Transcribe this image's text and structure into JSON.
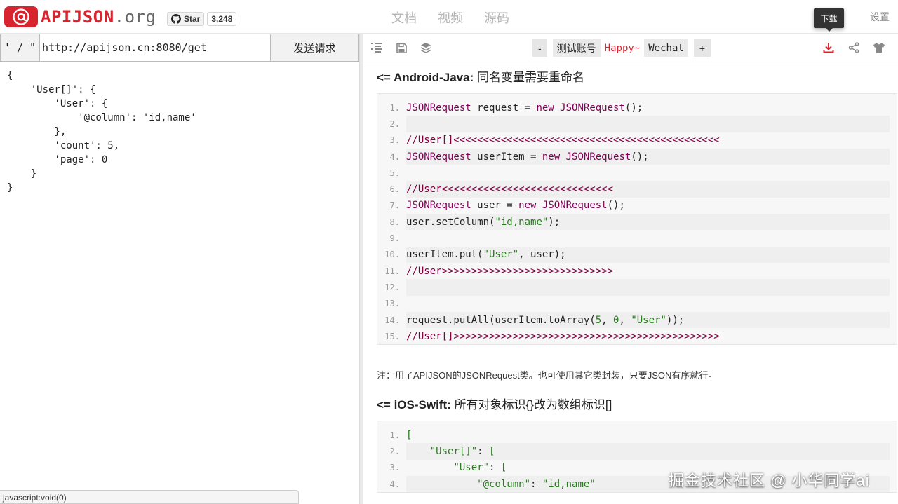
{
  "header": {
    "logo_symbol": "@",
    "logo_name": "APIJSON",
    "logo_tld": ".org",
    "star_label": "Star",
    "star_count": "3,248",
    "nav": [
      "文档",
      "视频",
      "源码"
    ],
    "settings": "设置",
    "tooltip": "下载"
  },
  "left": {
    "quote_label": "' / \"",
    "url_value": "http://apijson.cn:8080/get",
    "send_label": "发送请求",
    "request_body": "{\n    'User[]': {\n        'User': {\n            '@column': 'id,name'\n        },\n        'count': 5,\n        'page': 0\n    }\n}",
    "status_text": "javascript:void(0)"
  },
  "toolbar": {
    "icons": [
      "list-icon",
      "save-icon",
      "layers-icon",
      "download-icon",
      "share-icon",
      "shirt-icon"
    ],
    "minus": "-",
    "plus": "+",
    "accounts": [
      {
        "label": "测试账号",
        "active": false
      },
      {
        "label": "Happy~",
        "active": true
      },
      {
        "label": "Wechat",
        "active": false
      }
    ],
    "accent": "#d8242f"
  },
  "sections": [
    {
      "title_prefix": "<= Android-Java:",
      "title_rest": " 同名变量需要重命名",
      "lines": [
        [
          [
            "k",
            "JSONRequest"
          ],
          [
            "t",
            " request = "
          ],
          [
            "k",
            "new"
          ],
          [
            "t",
            " "
          ],
          [
            "k",
            "JSONRequest"
          ],
          [
            "t",
            "();"
          ]
        ],
        [],
        [
          [
            "c",
            "//User[]<<<<<<<<<<<<<<<<<<<<<<<<<<<<<<<<<<<<<<<<<<<<<"
          ]
        ],
        [
          [
            "k",
            "JSONRequest"
          ],
          [
            "t",
            " userItem = "
          ],
          [
            "k",
            "new"
          ],
          [
            "t",
            " "
          ],
          [
            "k",
            "JSONRequest"
          ],
          [
            "t",
            "();"
          ]
        ],
        [],
        [
          [
            "c",
            "//User<<<<<<<<<<<<<<<<<<<<<<<<<<<<<"
          ]
        ],
        [
          [
            "k",
            "JSONRequest"
          ],
          [
            "t",
            " user = "
          ],
          [
            "k",
            "new"
          ],
          [
            "t",
            " "
          ],
          [
            "k",
            "JSONRequest"
          ],
          [
            "t",
            "();"
          ]
        ],
        [
          [
            "t",
            "user.setColumn("
          ],
          [
            "s",
            "\"id,name\""
          ],
          [
            "t",
            ");"
          ]
        ],
        [],
        [
          [
            "t",
            "userItem.put("
          ],
          [
            "s",
            "\"User\""
          ],
          [
            "t",
            ", user);"
          ]
        ],
        [
          [
            "c",
            "//User>>>>>>>>>>>>>>>>>>>>>>>>>>>>>"
          ]
        ],
        [],
        [],
        [
          [
            "t",
            "request.putAll(userItem.toArray("
          ],
          [
            "s",
            "5"
          ],
          [
            "t",
            ", "
          ],
          [
            "s",
            "0"
          ],
          [
            "t",
            ", "
          ],
          [
            "s",
            "\"User\""
          ],
          [
            "t",
            "));"
          ]
        ],
        [
          [
            "c",
            "//User[]>>>>>>>>>>>>>>>>>>>>>>>>>>>>>>>>>>>>>>>>>>>>>"
          ]
        ]
      ]
    },
    {
      "note": "注：用了APIJSON的JSONRequest类。也可使用其它类封装，只要JSON有序就行。"
    },
    {
      "title_prefix": "<= iOS-Swift:",
      "title_rest": " 所有对象标识{}改为数组标识[]",
      "lines": [
        [
          [
            "s",
            "["
          ]
        ],
        [
          [
            "t",
            "    "
          ],
          [
            "s",
            "\"User[]\""
          ],
          [
            "t",
            ": "
          ],
          [
            "s",
            "["
          ]
        ],
        [
          [
            "t",
            "        "
          ],
          [
            "s",
            "\"User\""
          ],
          [
            "t",
            ": "
          ],
          [
            "s",
            "["
          ]
        ],
        [
          [
            "t",
            "            "
          ],
          [
            "s",
            "\"@column\""
          ],
          [
            "t",
            ": "
          ],
          [
            "s",
            "\"id,name\""
          ]
        ]
      ]
    }
  ],
  "watermark": "掘金技术社区 @ 小华同学ai"
}
